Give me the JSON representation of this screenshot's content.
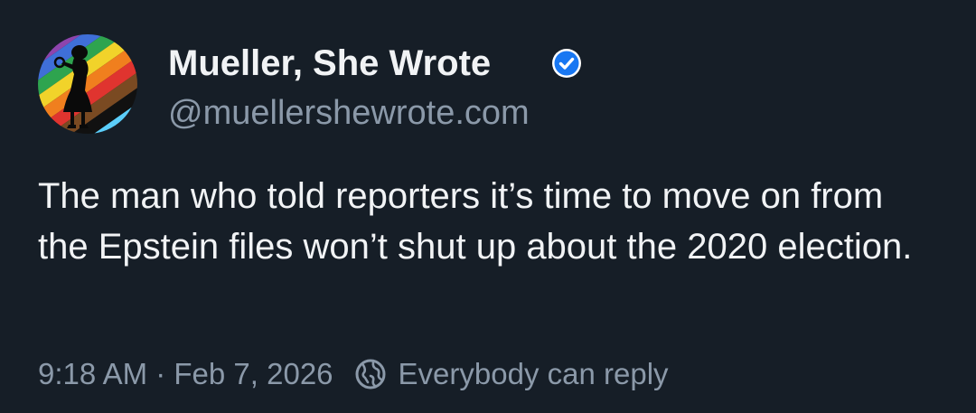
{
  "post": {
    "author": {
      "display_name": "Mueller, She Wrote",
      "handle": "@muellershewrote.com",
      "verified": true,
      "avatar_icon": "rainbow-silhouette-avatar"
    },
    "text": "The man who told reporters it’s time to move on from the Epstein files won’t shut up about the 2020 election.",
    "timestamp": "9:18 AM · Feb 7, 2026",
    "reply_setting": "Everybody can reply",
    "reply_icon": "globe-icon"
  },
  "colors": {
    "background": "#161e27",
    "text_primary": "#f1f3f5",
    "text_secondary": "#8b99a9",
    "verified_blue": "#1877f2"
  }
}
